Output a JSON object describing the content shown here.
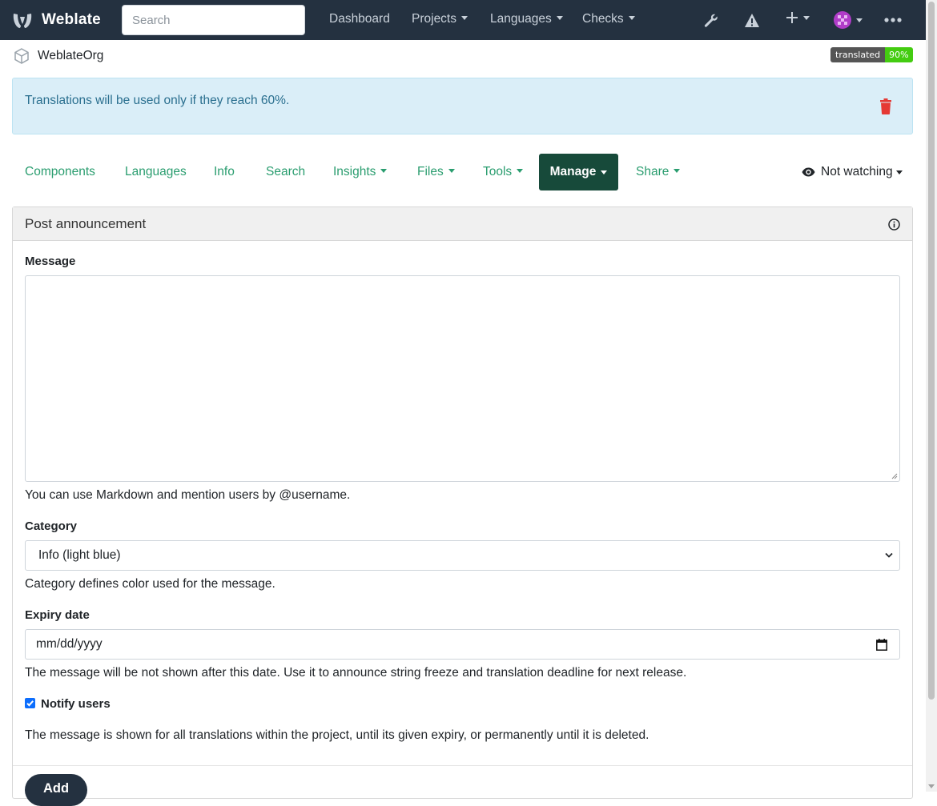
{
  "navbar": {
    "brand": "Weblate",
    "search_placeholder": "Search",
    "links": [
      "Dashboard",
      "Projects",
      "Languages",
      "Checks"
    ],
    "icons": [
      "wrench-icon",
      "warning-icon",
      "plus-icon",
      "avatar",
      "more-icon"
    ]
  },
  "breadcrumb": {
    "org_name": "WeblateOrg"
  },
  "badge": {
    "label": "translated",
    "value": "90%"
  },
  "alert": {
    "text": "Translations will be used only if they reach 60%."
  },
  "tabs": [
    {
      "label": "Components"
    },
    {
      "label": "Languages"
    },
    {
      "label": "Info"
    },
    {
      "label": "Search"
    },
    {
      "label": "Insights"
    },
    {
      "label": "Files"
    },
    {
      "label": "Tools"
    },
    {
      "label": "Manage"
    },
    {
      "label": "Share"
    }
  ],
  "watch": {
    "label": "Not watching"
  },
  "form": {
    "panel_title": "Post announcement",
    "message_label": "Message",
    "message_value": "",
    "message_help": "You can use Markdown and mention users by @username.",
    "category_label": "Category",
    "category_value": "Info (light blue)",
    "category_help": "Category defines color used for the message.",
    "expiry_label": "Expiry date",
    "expiry_placeholder": "mm/dd/yyyy",
    "expiry_help": "The message will be not shown after this date. Use it to announce string freeze and translation deadline for next release.",
    "notify_label": "Notify users",
    "notify_checked": true,
    "footer_help": "The message is shown for all translations within the project, until its given expiry, or permanently until it is deleted.",
    "submit_label": "Add"
  },
  "colors": {
    "navbar_bg": "#243140",
    "accent_green": "#2a9d6f",
    "active_tab_bg": "#174a3a",
    "alert_bg": "#daeef8",
    "alert_text": "#2a6f8f",
    "delete_red": "#e53935",
    "badge_green": "#44cc11"
  }
}
